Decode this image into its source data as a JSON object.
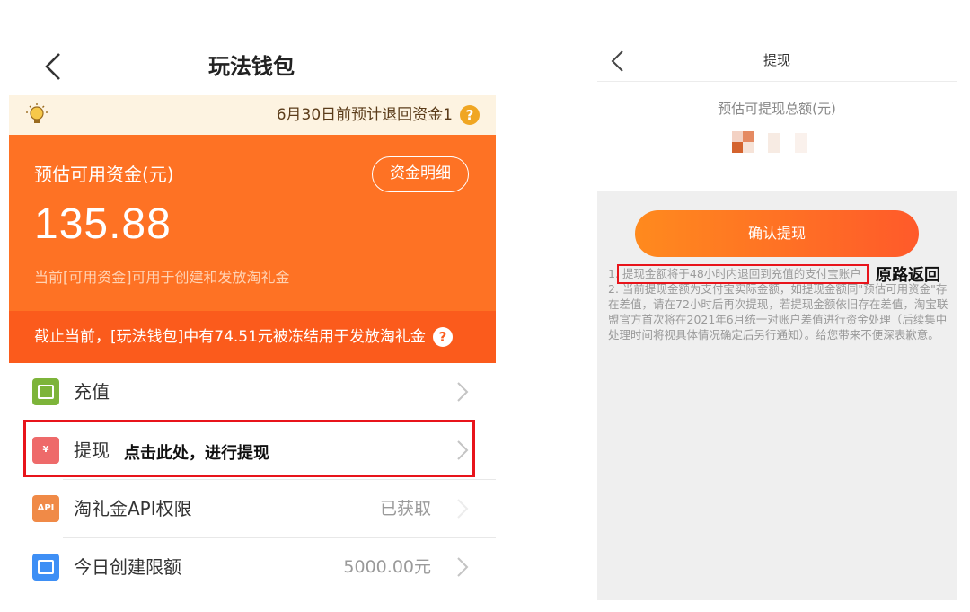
{
  "left": {
    "header": {
      "title": "玩法钱包"
    },
    "notice": {
      "text": "6月30日前预计退回资金1",
      "bulb_color": "#f0a623"
    },
    "card": {
      "label": "预估可用资金(元)",
      "detail_button": "资金明细",
      "amount": "135.88",
      "subtitle": "当前[可用资金]可用于创建和发放淘礼金",
      "color": "#fe7224"
    },
    "frozen": {
      "text": "截止当前，[玩法钱包]中有74.51元被冻结用于发放淘礼金"
    },
    "menu": [
      {
        "label": "充值",
        "value": "",
        "icon": "recharge-icon"
      },
      {
        "label": "提现",
        "value": "",
        "icon": "withdraw-icon"
      },
      {
        "label": "淘礼金API权限",
        "value": "已获取",
        "icon": "api-icon",
        "icon_text": "API"
      },
      {
        "label": "今日创建限额",
        "value": "5000.00元",
        "icon": "limit-icon"
      }
    ],
    "annotation": "点击此处，进行提现"
  },
  "right": {
    "header": {
      "title": "提现"
    },
    "subtitle": "预估可提现总额(元)",
    "confirm_button": "确认提现",
    "notes": [
      "1. 提现金额将于48小时内退回到充值的支付宝账户",
      "2. 当前提现金额为支付宝实际金额，如提现金额同\"预估可用资金\"存在差值，请在72小时后再次提现，若提现金额依旧存在差值，淘宝联盟官方首次将在2021年6月统一对账户差值进行资金处理（后续集中处理时间将视具体情况确定后另行通知）。给您带来不便深表歉意。"
    ],
    "annotation": "原路返回"
  },
  "colors": {
    "accent": "#fe7224",
    "highlight": "#e8141b"
  }
}
